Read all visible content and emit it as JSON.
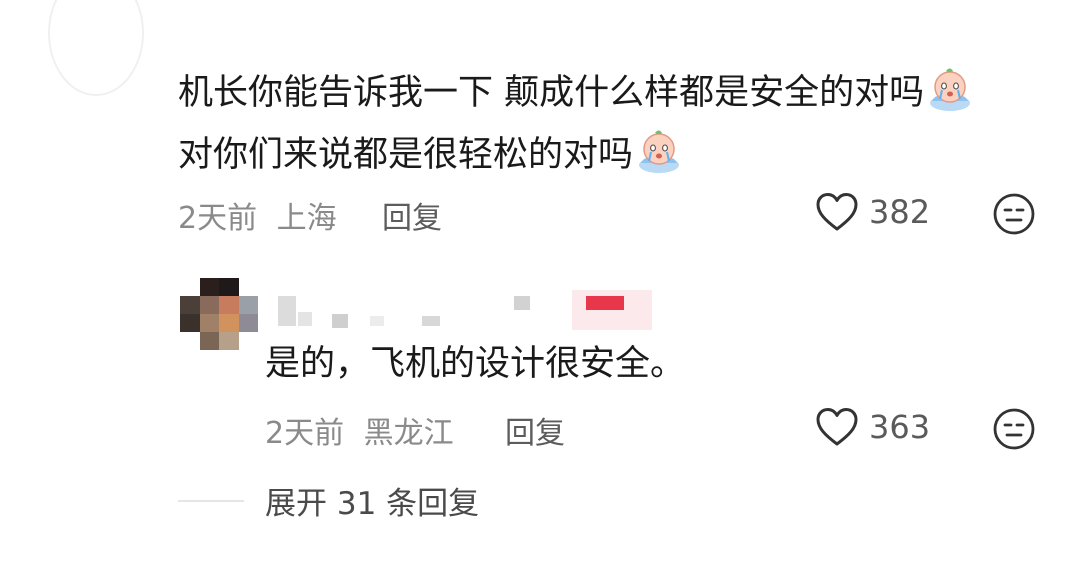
{
  "comment": {
    "line1": "机长你能告诉我一下 颠成什么样都是安全的对吗",
    "line2": "对你们来说都是很轻松的对吗",
    "emoji_icon": "crying-face-emoji",
    "time": "2天前",
    "location": "上海",
    "reply_label": "回复",
    "like_count": "382"
  },
  "reply": {
    "text": "是的，飞机的设计很安全。",
    "time": "2天前",
    "location": "黑龙江",
    "reply_label": "回复",
    "like_count": "363"
  },
  "expand_label": "展开 31 条回复",
  "icons": {
    "like": "heart-outline-icon",
    "dislike": "neutral-face-icon"
  },
  "colors": {
    "text": "#1a1a1a",
    "meta": "#8a8a8a",
    "highlight": "#e8374a"
  }
}
